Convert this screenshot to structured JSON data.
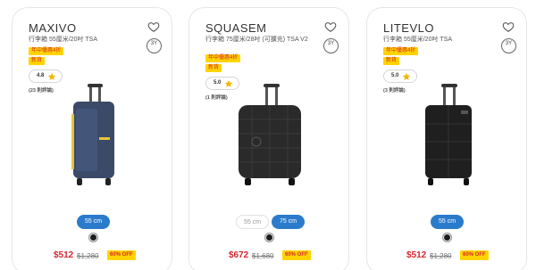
{
  "products": [
    {
      "name": "MAXIVO",
      "subtitle": "行李箱 55厘米/20吋 TSA",
      "badge1": "年中優惠4折",
      "badge2": "新貨",
      "rating": "4.8",
      "reviews": "(23 則評論)",
      "warranty": "3Y",
      "sizes": [
        "55 cm"
      ],
      "active_size": "55 cm",
      "price": "$512",
      "original_price": "$1,280",
      "discount": "60% OFF",
      "body_color": "#3b4a66",
      "accent_color": "#e8c33a"
    },
    {
      "name": "SQUASEM",
      "subtitle": "行李箱 75厘米/28吋 (可擴充) TSA V2",
      "badge1": "年中優惠4折",
      "badge2": "新貨",
      "rating": "5.0",
      "reviews": "(1 則評論)",
      "warranty": "3Y",
      "sizes": [
        "55 cm",
        "75 cm"
      ],
      "active_size": "75 cm",
      "price": "$672",
      "original_price": "$1,680",
      "discount": "60% OFF",
      "body_color": "#2a2a2a",
      "accent_color": "#2a2a2a"
    },
    {
      "name": "LITEVLO",
      "subtitle": "行李箱 55厘米/20吋 TSA",
      "badge1": "年中優惠4折",
      "badge2": "新貨",
      "rating": "5.0",
      "reviews": "(3 則評論)",
      "warranty": "3Y",
      "sizes": [
        "55 cm"
      ],
      "active_size": "55 cm",
      "price": "$512",
      "original_price": "$1,280",
      "discount": "60% OFF",
      "body_color": "#1f1f1f",
      "accent_color": "#1f1f1f"
    }
  ],
  "icons": {
    "wishlist": "heart-icon",
    "star": "star-icon",
    "warranty": "warranty-badge-icon"
  },
  "colors": {
    "price_red": "#d7262f",
    "badge_yellow": "#ffd400",
    "size_blue": "#2b7bcc"
  }
}
